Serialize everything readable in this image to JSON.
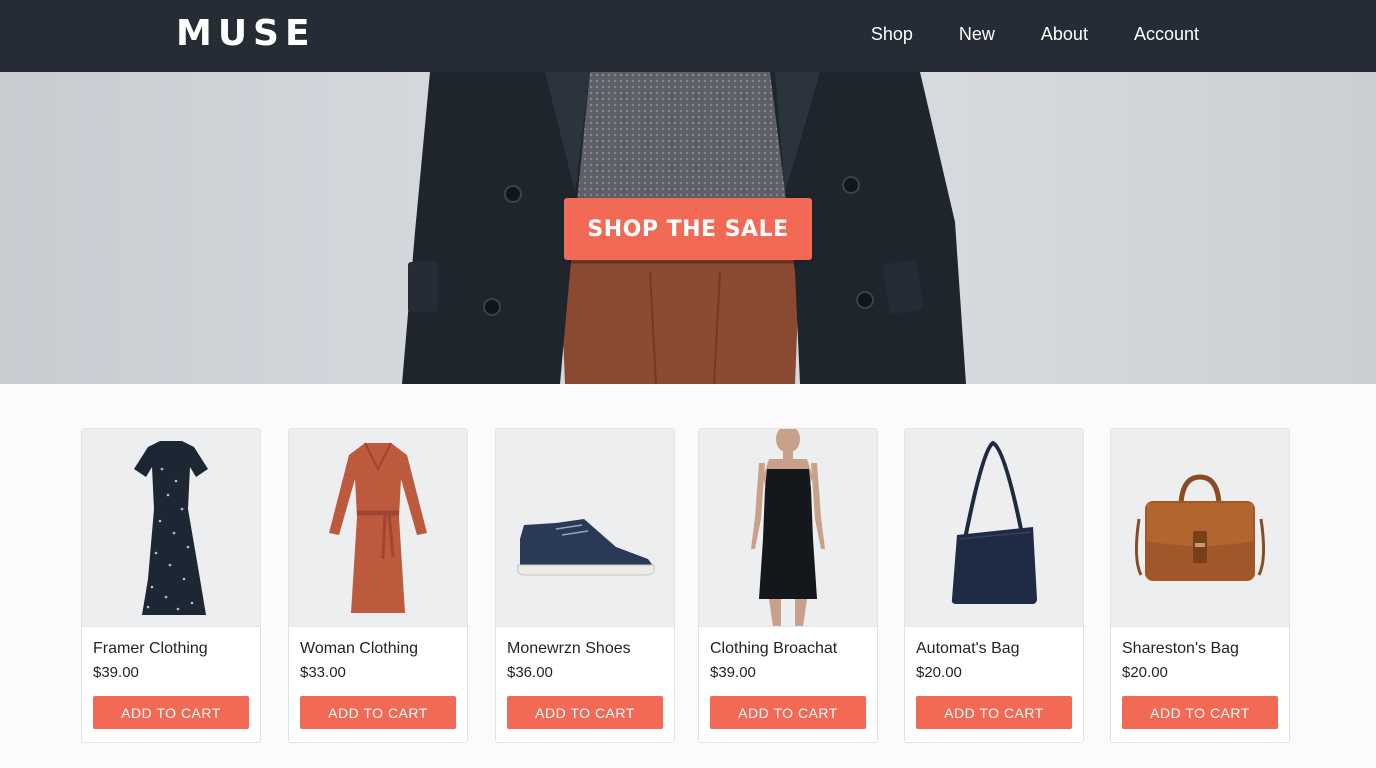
{
  "header": {
    "logo": "MUSE",
    "nav": [
      "Shop",
      "New",
      "About",
      "Account"
    ]
  },
  "hero": {
    "cta_label": "SHOP THE SALE"
  },
  "products": [
    {
      "name": "Framer Clothing",
      "price": "$39.00",
      "button": "ADD TO CART",
      "icon": "polka-dot-dress"
    },
    {
      "name": "Woman Clothing",
      "price": "$33.00",
      "button": "ADD TO CART",
      "icon": "rust-wrap-dress"
    },
    {
      "name": "Monewrzn Shoes",
      "price": "$36.00",
      "button": "ADD TO CART",
      "icon": "navy-sneaker"
    },
    {
      "name": "Clothing Broachat",
      "price": "$39.00",
      "button": "ADD TO CART",
      "icon": "black-slip-dress"
    },
    {
      "name": "Automat's Bag",
      "price": "$20.00",
      "button": "ADD TO CART",
      "icon": "navy-tote-bag"
    },
    {
      "name": "Shareston's Bag",
      "price": "$20.00",
      "button": "ADD TO CART",
      "icon": "brown-satchel-bag"
    }
  ],
  "colors": {
    "header_bg": "#262c35",
    "accent": "#f26a55",
    "page_bg": "#fbfbfb"
  }
}
